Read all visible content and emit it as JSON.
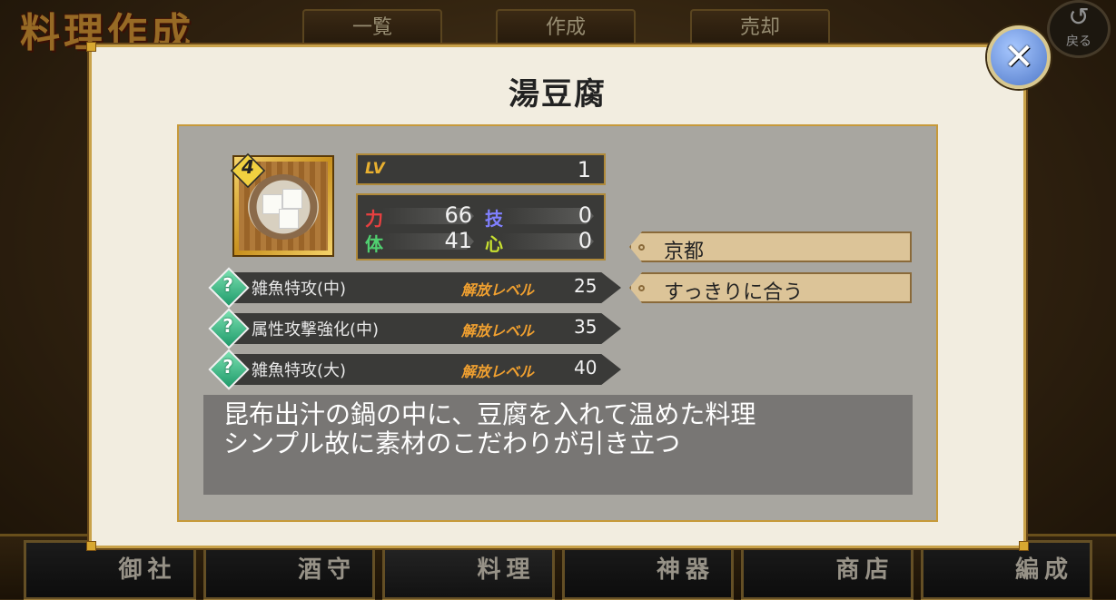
{
  "background": {
    "screen_title": "料理作成",
    "tabs": [
      "一覧",
      "作成",
      "売却"
    ],
    "back_label": "戻る",
    "nav": [
      "御社",
      "酒守",
      "料理",
      "神器",
      "商店",
      "編成"
    ]
  },
  "modal": {
    "title": "湯豆腐",
    "item": {
      "rarity": "4",
      "lv_label": "LV",
      "lv_value": "1",
      "stats": {
        "power_label": "力",
        "power_value": "66",
        "skill_label": "技",
        "skill_value": "0",
        "body_label": "体",
        "body_value": "41",
        "heart_label": "心",
        "heart_value": "0"
      }
    },
    "tags": [
      "京都",
      "すっきりに合う"
    ],
    "skills": [
      {
        "icon": "?",
        "name": "雑魚特攻(中)",
        "level_label": "解放レベル",
        "level": "25"
      },
      {
        "icon": "?",
        "name": "属性攻撃強化(中)",
        "level_label": "解放レベル",
        "level": "35"
      },
      {
        "icon": "?",
        "name": "雑魚特攻(大)",
        "level_label": "解放レベル",
        "level": "40"
      }
    ],
    "description": [
      "昆布出汁の鍋の中に、豆腐を入れて温めた料理",
      "シンプル故に素材のこだわりが引き立つ"
    ],
    "close_icon": "✕"
  },
  "colors": {
    "power": "#e84040",
    "skill": "#8080ff",
    "body": "#50d070",
    "heart": "#c8e030",
    "accent": "#c9a24a"
  }
}
